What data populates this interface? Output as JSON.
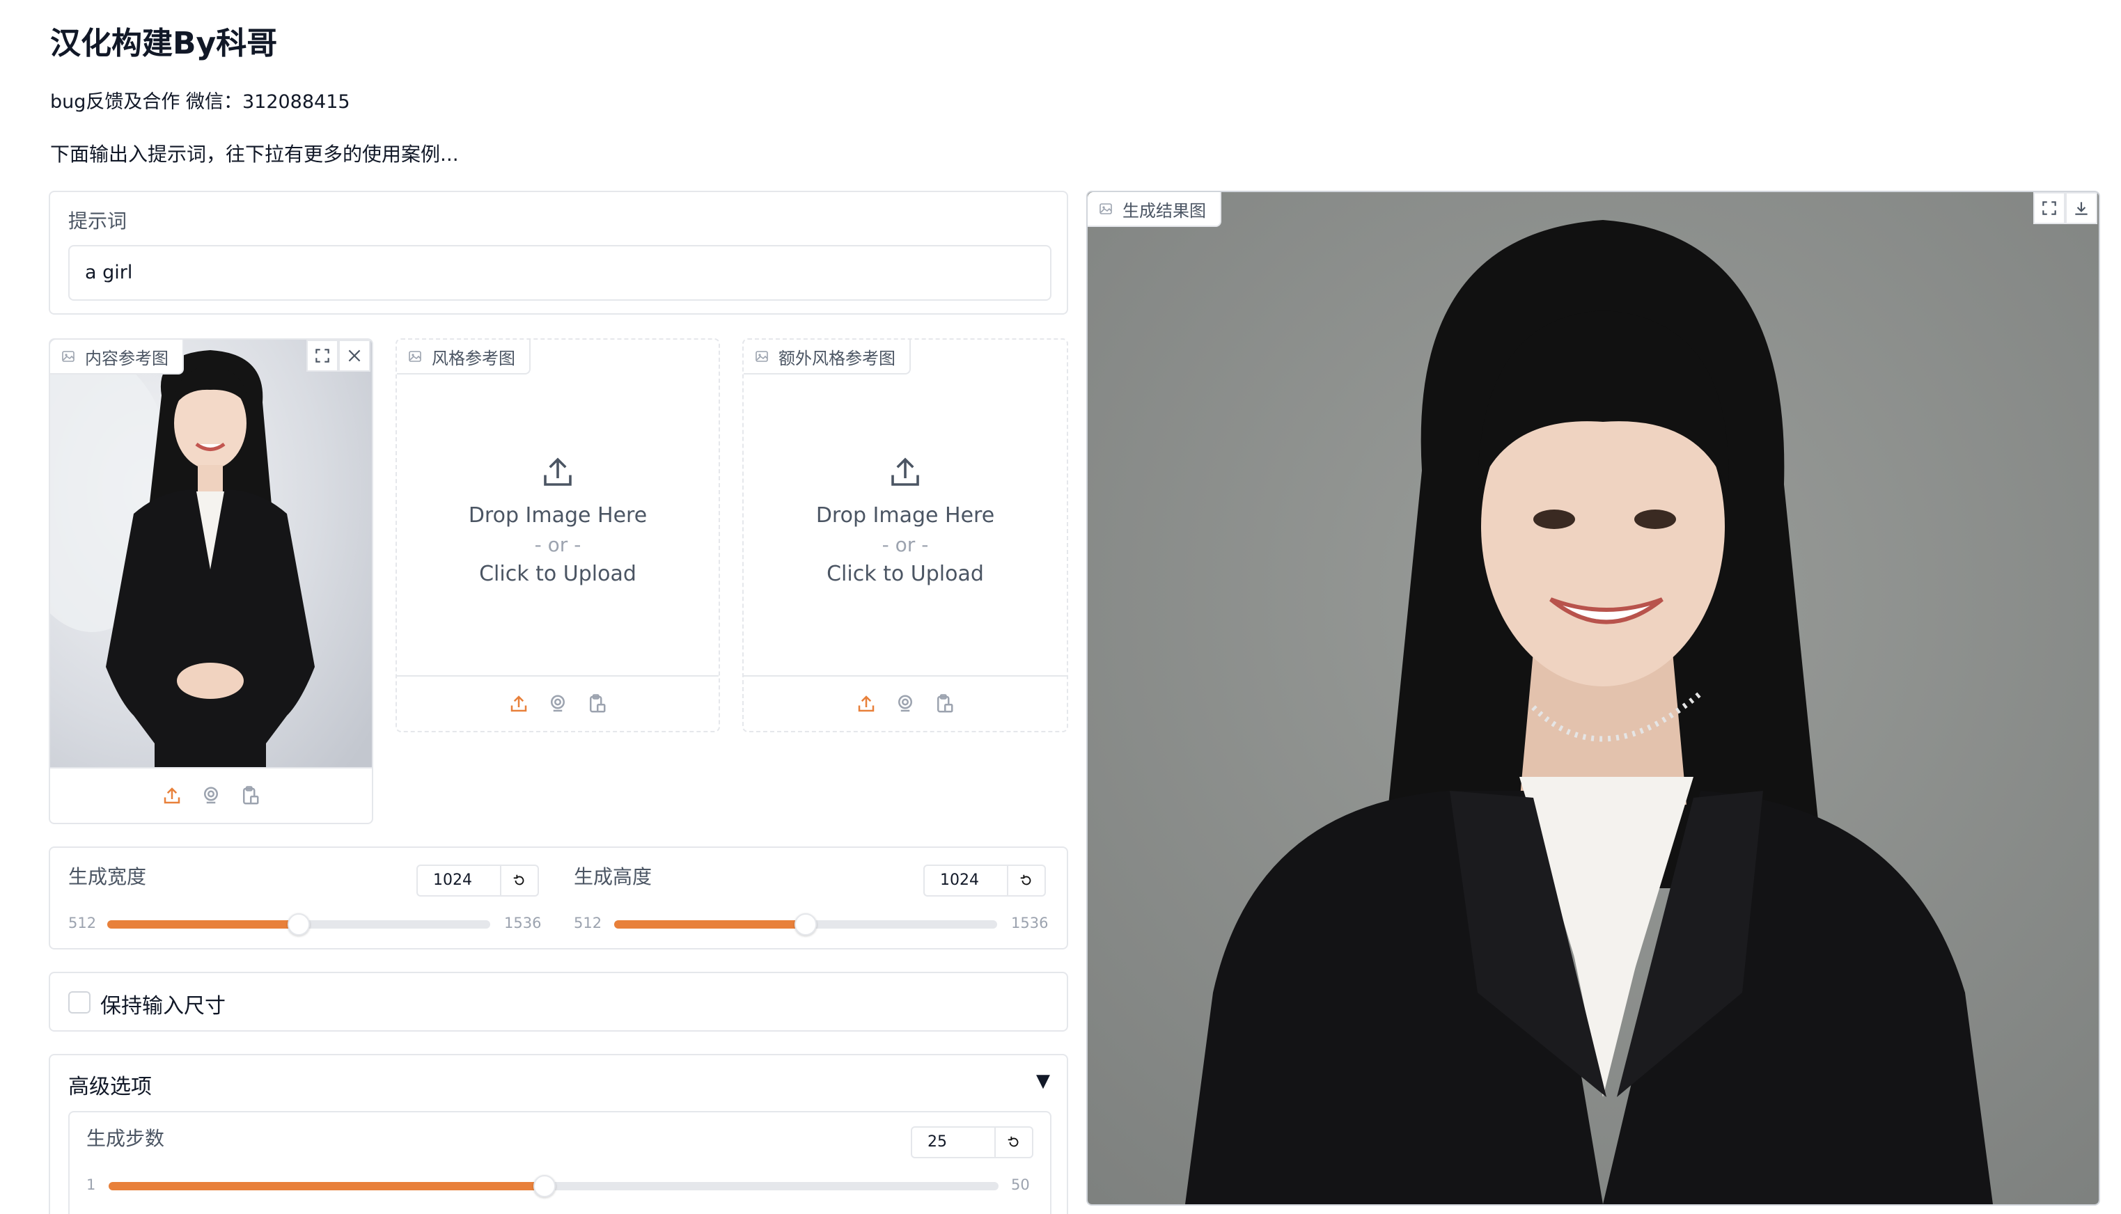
{
  "header": {
    "title": "汉化构建By科哥",
    "contact": "bug反馈及合作 微信：312088415",
    "instruction": "下面输出入提示词，往下拉有更多的使用案例..."
  },
  "prompt": {
    "label": "提示词",
    "value": "a girl"
  },
  "content_ref": {
    "label": "内容参考图"
  },
  "style_ref": {
    "label": "风格参考图",
    "drop_text": "Drop Image Here",
    "or_text": "- or -",
    "click_text": "Click to Upload"
  },
  "extra_style_ref": {
    "label": "额外风格参考图",
    "drop_text": "Drop Image Here",
    "or_text": "- or -",
    "click_text": "Click to Upload"
  },
  "width_slider": {
    "label": "生成宽度",
    "value": "1024",
    "min": "512",
    "max": "1536",
    "fraction": 0.5
  },
  "height_slider": {
    "label": "生成高度",
    "value": "1024",
    "min": "512",
    "max": "1536",
    "fraction": 0.5
  },
  "keep_size": {
    "label": "保持输入尺寸",
    "checked": false
  },
  "advanced": {
    "title": "高级选项",
    "arrow": "▼",
    "steps": {
      "label": "生成步数",
      "value": "25",
      "min": "1",
      "max": "50",
      "fraction": 0.49
    }
  },
  "result": {
    "label": "生成结果图"
  },
  "colors": {
    "accent": "#e8803a",
    "border": "#e5e7eb",
    "photo_bg": "#8b8e8c"
  }
}
